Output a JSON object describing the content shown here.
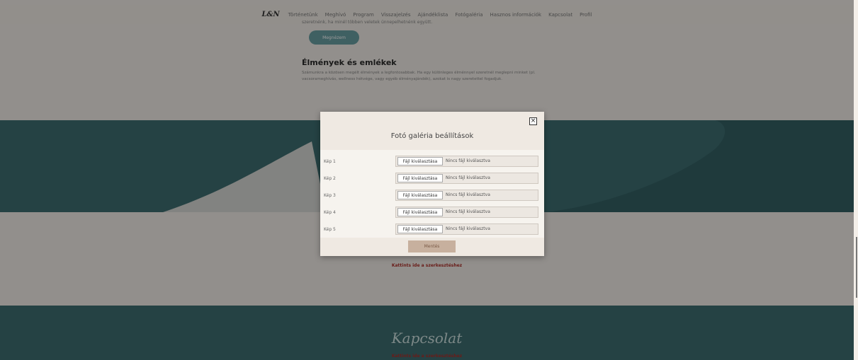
{
  "nav": {
    "logo": "L&N",
    "items": [
      "Történetünk",
      "Meghívó",
      "Program",
      "Visszajelzés",
      "Ajándéklista",
      "Fotógaléria",
      "Hasznos információk",
      "Kapcsolat",
      "Profil"
    ]
  },
  "section_rsvp": {
    "tail_text": "szeretnénk, ha minél többen veletek ünnepelhetnénk együtt.",
    "button_label": "Megnézem"
  },
  "section_memories": {
    "title": "Élmények és emlékek",
    "body": "Számunkra a közösen megélt élmények a legfontosabbak. Ha egy különleges élménnyel szeretnél meglepni minket (pl. vacsorameghívás, wellness hétvége, vagy egyéb élményajándék), azokat is nagy szeretettel fogadjuk."
  },
  "edit_link": "Kattints ide a szerkesztéshez",
  "footer": {
    "title": "Kapcsolat",
    "edit_link": "Kattints ide a szerkesztéshez"
  },
  "modal": {
    "title": "Fotó galéria beállítások",
    "close_glyph": "×",
    "file_button_label": "Fájl kiválasztása",
    "file_status": "Nincs fájl kiválasztva",
    "rows": [
      {
        "label": "Kép 1"
      },
      {
        "label": "Kép 2"
      },
      {
        "label": "Kép 3"
      },
      {
        "label": "Kép 4"
      },
      {
        "label": "Kép 5"
      }
    ],
    "save_label": "Mentés"
  },
  "colors": {
    "teal": "#3e6e72",
    "accent_button": "#6aa0a4",
    "link_red": "#b0302a",
    "save_button": "#c7b09e"
  }
}
